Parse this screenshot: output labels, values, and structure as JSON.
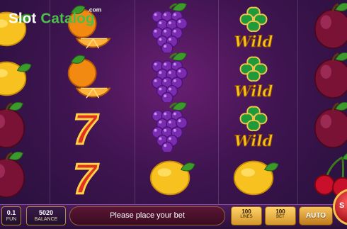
{
  "logo": {
    "brand_part1": "Slot",
    "brand_part2": "Catalog",
    "tld": ".com"
  },
  "reels": [
    [
      "lemon",
      "lemon",
      "plum",
      "plum"
    ],
    [
      "orange",
      "orange",
      "seven",
      "seven"
    ],
    [
      "grapes",
      "grapes",
      "grapes",
      "lemon"
    ],
    [
      "wild",
      "wild",
      "wild",
      "lemon"
    ],
    [
      "plum",
      "plum",
      "plum",
      "cherry"
    ]
  ],
  "wild_label": "Wild",
  "seven_label": "7",
  "bottom_bar": {
    "fun": {
      "value": "0.1",
      "label": "FUN"
    },
    "balance": {
      "value": "5020",
      "label": "BALANCE"
    },
    "message": "Please place your bet",
    "lines": {
      "value": "100",
      "label": "LINES"
    },
    "bet": {
      "value": "100",
      "label": "BET"
    },
    "auto_label": "AUTO",
    "spin_label": "S"
  },
  "colors": {
    "background": "#3f1450",
    "accent_gold": "#f3c44a",
    "logo_green": "#4bbe4b",
    "spin_red": "#d01c24"
  },
  "icons": [
    "lemon-icon",
    "orange-icon",
    "plum-icon",
    "grapes-icon",
    "seven-icon",
    "clover-wild-icon",
    "cherry-icon"
  ]
}
